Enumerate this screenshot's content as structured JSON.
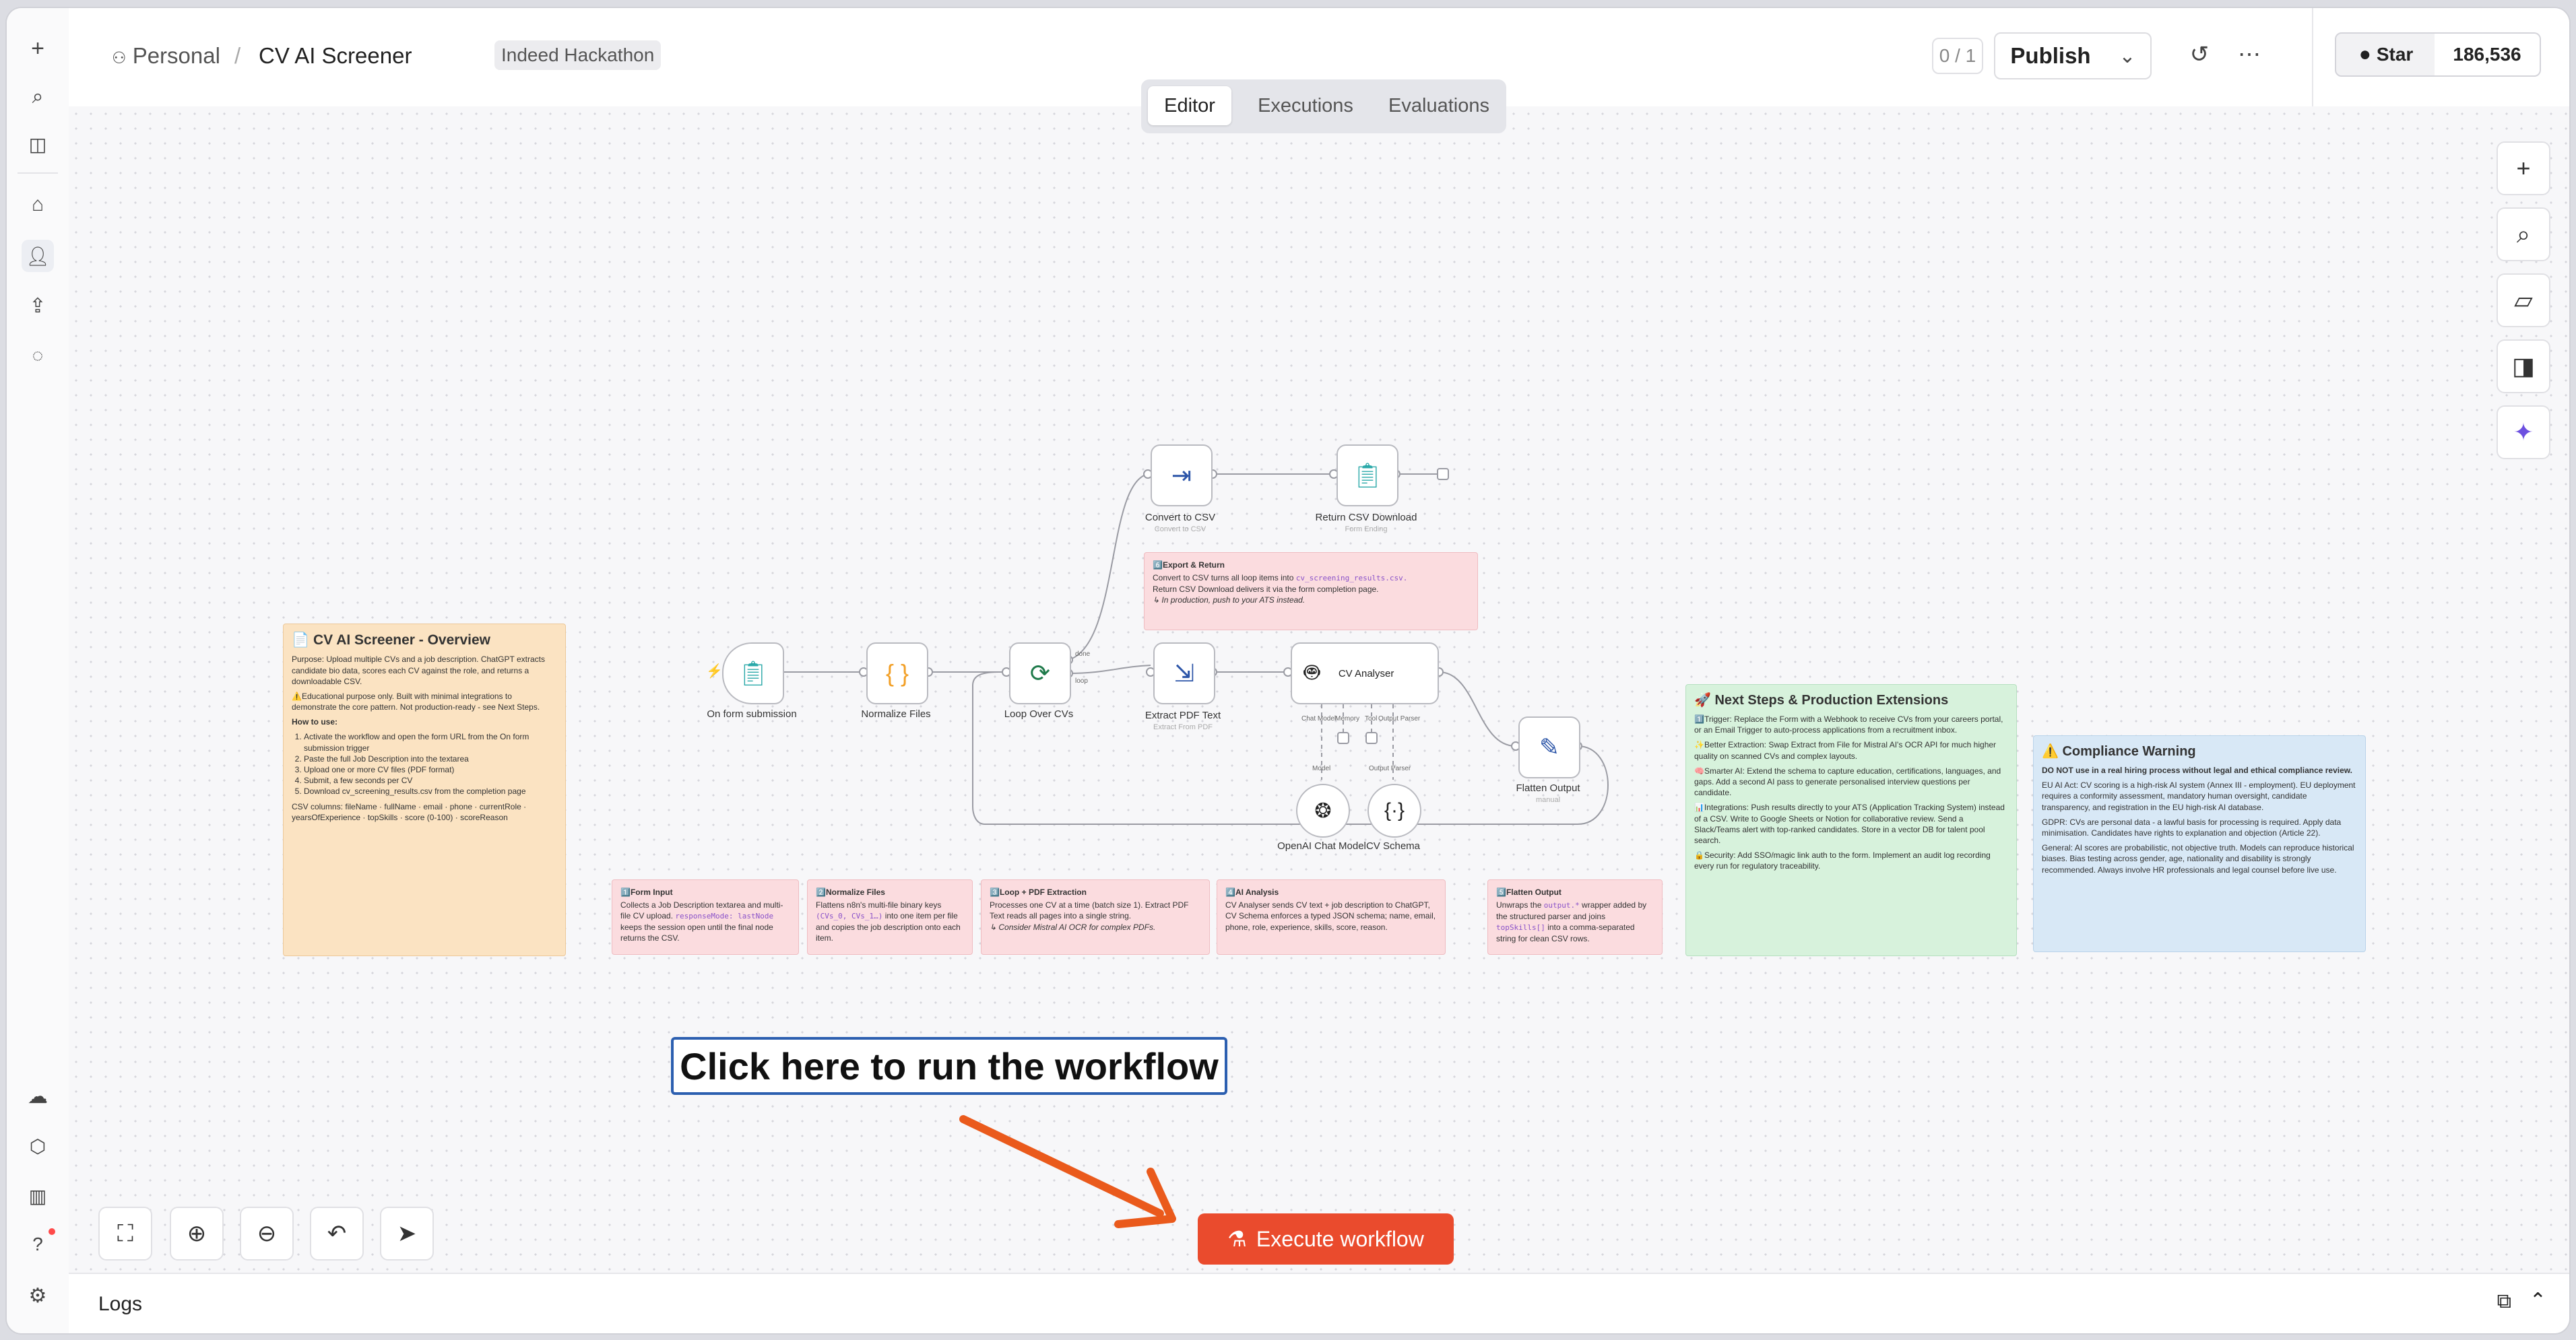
{
  "breadcrumb": {
    "owner": "Personal",
    "separator": "/",
    "workflow_name": "CV AI Screener",
    "tag": "Indeed Hackathon"
  },
  "header": {
    "counter": "0 / 1",
    "publish_label": "Publish",
    "star_label": "Star",
    "star_count": "186,536"
  },
  "tabs": [
    {
      "label": "Editor",
      "active": true
    },
    {
      "label": "Executions",
      "active": false
    },
    {
      "label": "Evaluations",
      "active": false
    }
  ],
  "sidebar": {
    "icons": [
      "plus-icon",
      "search-icon",
      "panel-icon",
      "home-icon",
      "user-icon",
      "share-icon",
      "chat-icon",
      "cloud-icon",
      "cube-icon",
      "chart-icon",
      "help-icon",
      "settings-icon"
    ]
  },
  "nodes": {
    "form": {
      "label": "On form submission"
    },
    "normalize": {
      "label": "Normalize Files"
    },
    "loop": {
      "label": "Loop Over CVs",
      "done": "done",
      "loop": "loop"
    },
    "convert": {
      "label": "Convert to CSV",
      "sub": "Convert to CSV"
    },
    "return_csv": {
      "label": "Return CSV Download",
      "sub": "Form Ending"
    },
    "extract": {
      "label": "Extract PDF Text",
      "sub": "Extract From PDF"
    },
    "analyser": {
      "label": "CV Analyser",
      "chat_model": "Chat Model",
      "memory": "Memory",
      "tool": "Tool",
      "parser": "Output Parser"
    },
    "flatten": {
      "label": "Flatten Output",
      "sub": "manual"
    },
    "openai": {
      "label": "OpenAI Chat Model",
      "port": "Model"
    },
    "schema": {
      "label": "CV Schema",
      "port": "Output Parser"
    }
  },
  "notes": {
    "overview": {
      "title": "📄 CV AI Screener - Overview",
      "purpose": "Purpose: Upload multiple CVs and a job description. ChatGPT extracts candidate bio data, scores each CV against the role, and returns a downloadable CSV.",
      "edu": "⚠️Educational purpose only. Built with minimal integrations to demonstrate the core pattern. Not production-ready - see Next Steps.",
      "howto": "How to use:",
      "steps": [
        "Activate the workflow and open the form URL from the On form submission trigger",
        "Paste the full Job Description into the textarea",
        "Upload one or more CV files (PDF format)",
        "Submit, a few seconds per CV",
        "Download cv_screening_results.csv from the completion page"
      ],
      "columns": "CSV columns: fileName · fullName · email · phone · currentRole · yearsOfExperience · topSkills · score (0-100) · scoreReason"
    },
    "export": {
      "title": "6️⃣Export & Return",
      "body1": "Convert to CSV turns all loop items into",
      "code": "cv_screening_results.csv.",
      "body2": "Return CSV Download delivers it via the form completion page.",
      "body3": "↳ In production, push to your ATS instead."
    },
    "n1": {
      "title": "1️⃣Form Input",
      "body": "Collects a Job Description textarea and multi-file CV upload.",
      "code": "responseMode: lastNode",
      "body2": "keeps the session open until the final node returns the CSV."
    },
    "n2": {
      "title": "2️⃣Normalize Files",
      "body": "Flattens n8n's multi-file binary keys",
      "code": "(CVs_0, CVs_1…)",
      "body2": "into one item per file and copies the job description onto each item."
    },
    "n3": {
      "title": "3️⃣Loop + PDF Extraction",
      "body": "Processes one CV at a time (batch size 1). Extract PDF Text reads all pages into a single string.",
      "body2": "↳ Consider Mistral AI OCR for complex PDFs."
    },
    "n4": {
      "title": "4️⃣AI Analysis",
      "body": "CV Analyser sends CV text + job description to ChatGPT, CV Schema enforces a typed JSON schema; name, email, phone, role, experience, skills, score, reason."
    },
    "n5": {
      "title": "5️⃣Flatten Output",
      "body": "Unwraps the",
      "code": "output.*",
      "body2": "wrapper added by the structured parser and joins",
      "code2": "topSkills[]",
      "body3": "into a comma-separated string for clean CSV rows."
    },
    "next": {
      "title": "🚀 Next Steps & Production Extensions",
      "items": [
        "1️⃣Trigger: Replace the Form with a Webhook to receive CVs from your careers portal, or an Email Trigger to auto-process applications from a recruitment inbox.",
        "✨Better Extraction: Swap Extract from File for Mistral AI's OCR API for much higher quality on scanned CVs and complex layouts.",
        "🧠Smarter AI: Extend the schema to capture education, certifications, languages, and gaps. Add a second AI pass to generate personalised interview questions per candidate.",
        "📊Integrations: Push results directly to your ATS (Application Tracking System) instead of a CSV. Write to Google Sheets or Notion for collaborative review. Send a Slack/Teams alert with top-ranked candidates. Store in a vector DB for talent pool search.",
        "🔒Security: Add SSO/magic link auth to the form. Implement an audit log recording every run for regulatory traceability."
      ]
    },
    "compliance": {
      "title": "⚠️ Compliance Warning",
      "lead": "DO NOT use in a real hiring process without legal and ethical compliance review.",
      "items": [
        "EU AI Act: CV scoring is a high-risk AI system (Annex III - employment). EU deployment requires a conformity assessment, mandatory human oversight, candidate transparency, and registration in the EU high-risk AI database.",
        "GDPR: CVs are personal data - a lawful basis for processing is required. Apply data minimisation. Candidates have rights to explanation and objection (Article 22).",
        "General: AI scores are probabilistic, not objective truth. Models can reproduce historical biases. Bias testing across gender, age, nationality and disability is strongly recommended. Always involve HR professionals and legal counsel before live use."
      ]
    }
  },
  "callout": "Click here to run the workflow",
  "execute_label": "Execute workflow",
  "logs_label": "Logs",
  "colors": {
    "accent": "#ea4b2d",
    "callout_border": "#2c5fb0",
    "arrow": "#ea5a1c"
  }
}
